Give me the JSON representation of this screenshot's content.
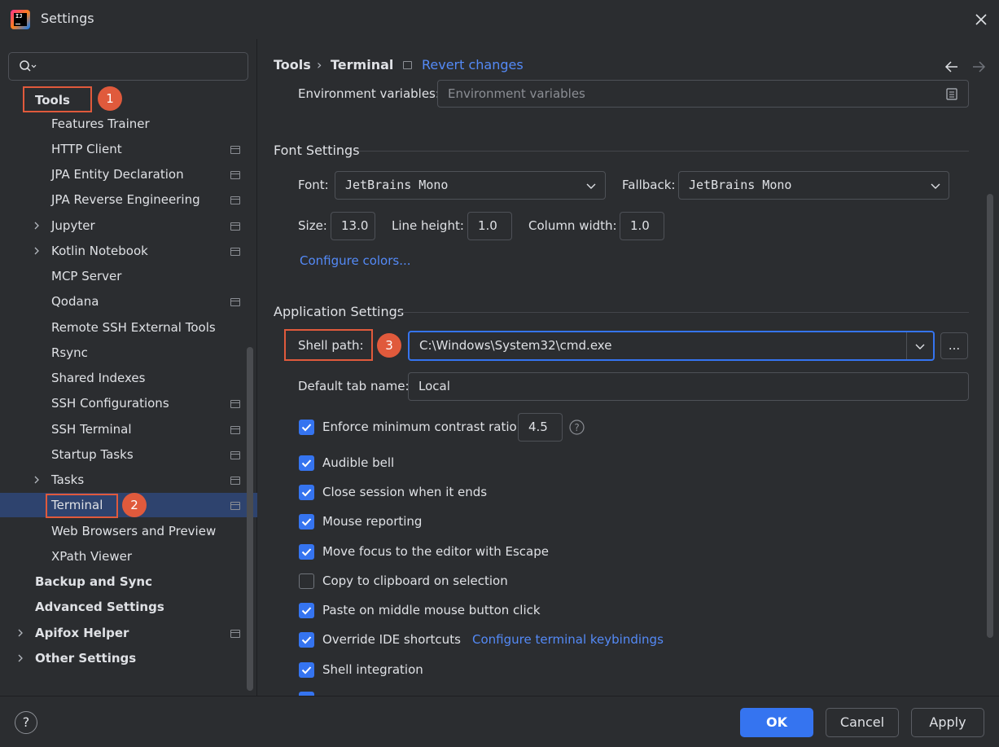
{
  "window": {
    "title": "Settings",
    "close_icon": "close-icon",
    "app_icon": "intellij-app-icon"
  },
  "sidebar": {
    "search_placeholder": "",
    "items": [
      {
        "label": "Tools",
        "bold": true
      },
      {
        "label": "Features Trainer"
      },
      {
        "label": "HTTP Client"
      },
      {
        "label": "JPA Entity Declaration"
      },
      {
        "label": "JPA Reverse Engineering"
      },
      {
        "label": "Jupyter"
      },
      {
        "label": "Kotlin Notebook"
      },
      {
        "label": "MCP Server"
      },
      {
        "label": "Qodana"
      },
      {
        "label": "Remote SSH External Tools"
      },
      {
        "label": "Rsync"
      },
      {
        "label": "Shared Indexes"
      },
      {
        "label": "SSH Configurations"
      },
      {
        "label": "SSH Terminal"
      },
      {
        "label": "Startup Tasks"
      },
      {
        "label": "Tasks"
      },
      {
        "label": "Terminal",
        "selected": true
      },
      {
        "label": "Web Browsers and Preview"
      },
      {
        "label": "XPath Viewer"
      },
      {
        "label": "Backup and Sync",
        "bold": true
      },
      {
        "label": "Advanced Settings",
        "bold": true
      },
      {
        "label": "Apifox Helper",
        "bold": true
      },
      {
        "label": "Other Settings",
        "bold": true
      }
    ]
  },
  "annotations": {
    "badge1": "1",
    "badge2": "2",
    "badge3": "3",
    "color": "#e05a3c"
  },
  "header": {
    "crumb_parent": "Tools",
    "crumb_sep": "›",
    "crumb_current": "Terminal",
    "revert_label": "Revert changes"
  },
  "env": {
    "label": "Environment variables:",
    "placeholder": "Environment variables"
  },
  "font_settings": {
    "title": "Font Settings",
    "font_label": "Font:",
    "font_value": "JetBrains Mono",
    "fallback_label": "Fallback:",
    "fallback_value": "JetBrains Mono",
    "size_label": "Size:",
    "size_value": "13.0",
    "line_height_label": "Line height:",
    "line_height_value": "1.0",
    "column_width_label": "Column width:",
    "column_width_value": "1.0",
    "configure_colors": "Configure colors..."
  },
  "app_settings": {
    "title": "Application Settings",
    "shell_path_label": "Shell path:",
    "shell_path_value": "C:\\Windows\\System32\\cmd.exe",
    "browse_label": "...",
    "default_tab_label": "Default tab name:",
    "default_tab_value": "Local",
    "contrast_label": "Enforce minimum contrast ratio:",
    "contrast_value": "4.5",
    "audible_bell": "Audible bell",
    "close_session": "Close session when it ends",
    "mouse_reporting": "Mouse reporting",
    "move_focus": "Move focus to the editor with Escape",
    "copy_clipboard": "Copy to clipboard on selection",
    "paste_middle": "Paste on middle mouse button click",
    "override_shortcuts": "Override IDE shortcuts",
    "configure_keybindings": "Configure terminal keybindings",
    "shell_integration": "Shell integration"
  },
  "footer": {
    "help": "?",
    "ok": "OK",
    "cancel": "Cancel",
    "apply": "Apply"
  },
  "colors": {
    "accent": "#3574f0",
    "link": "#548af7",
    "selection": "#2e436e",
    "background": "#2b2d30"
  }
}
